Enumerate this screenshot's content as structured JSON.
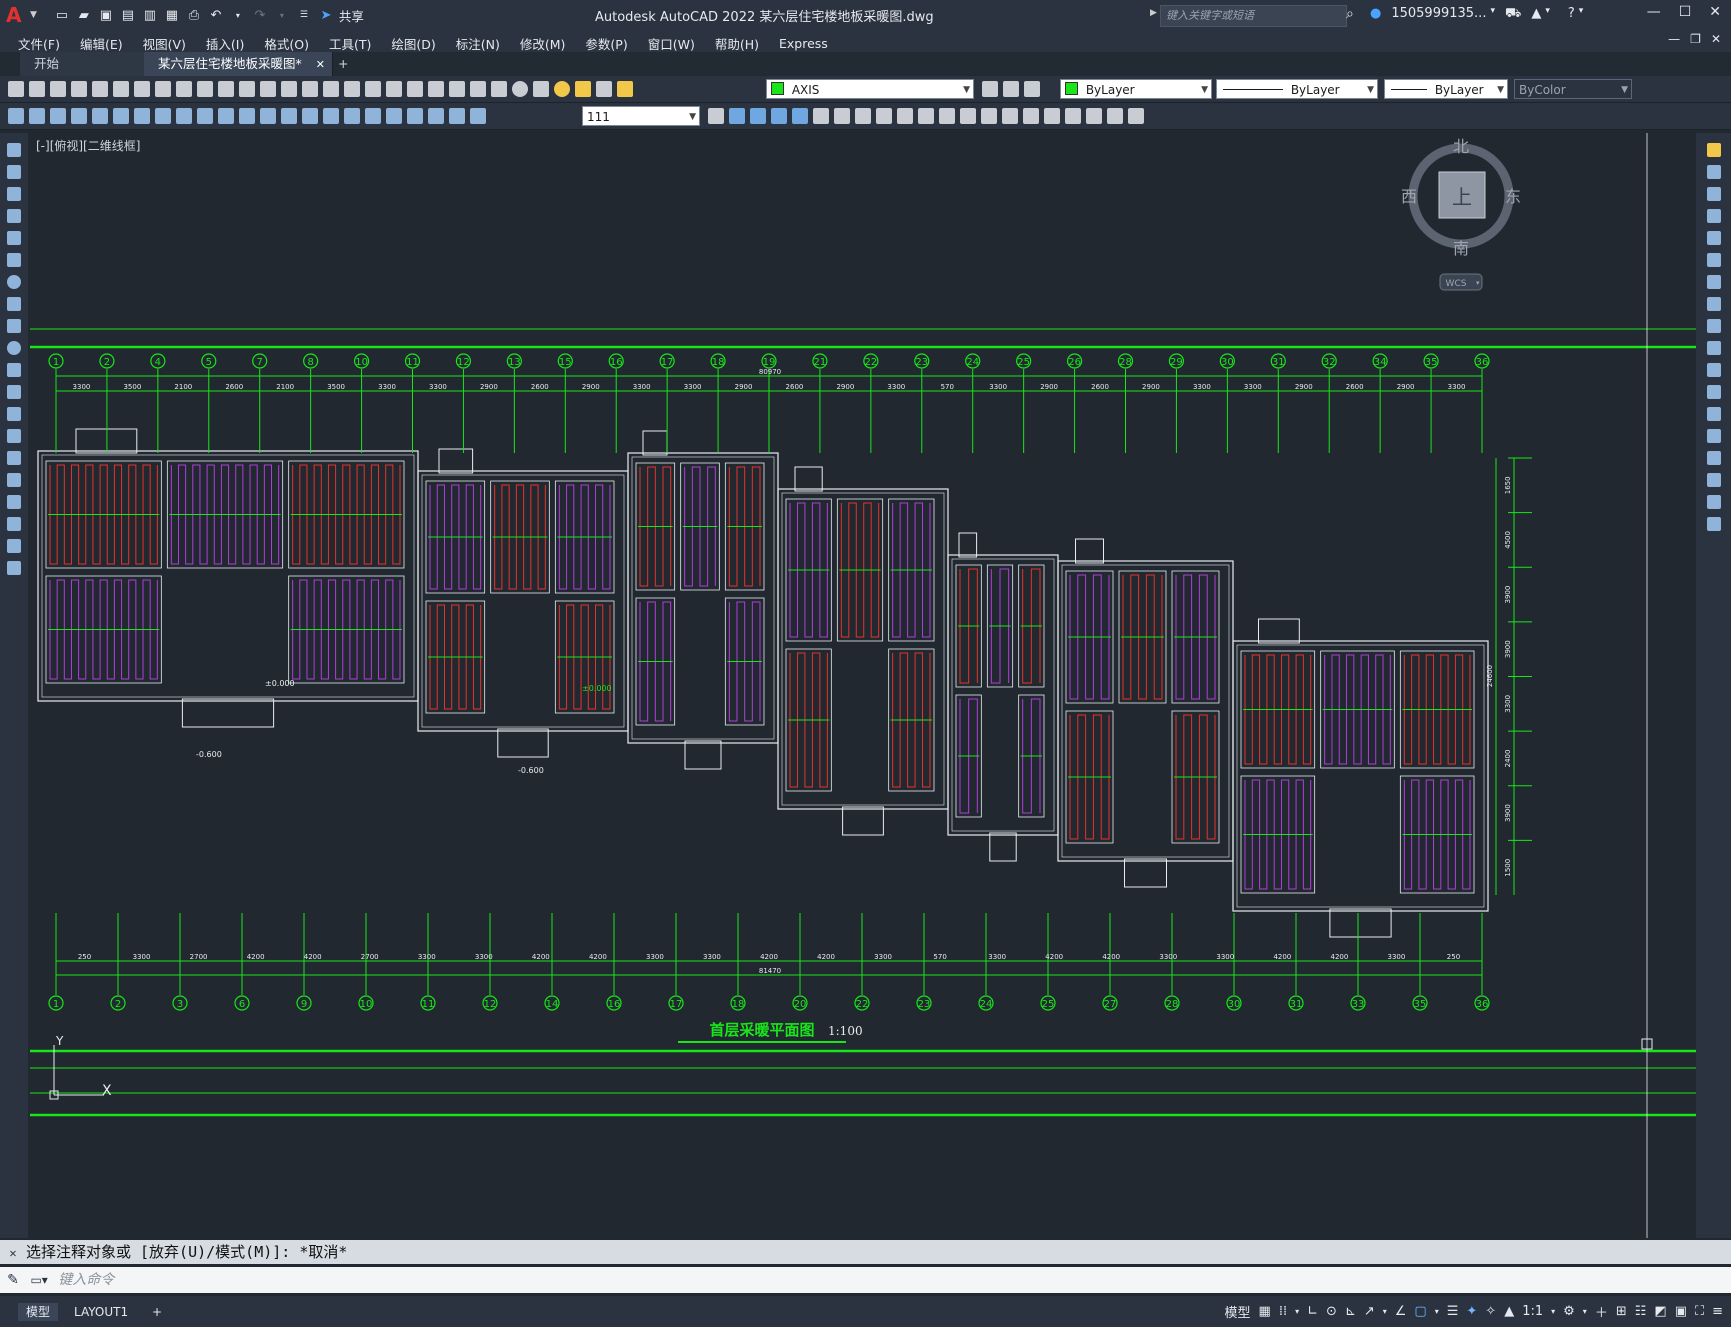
{
  "app": {
    "title": "Autodesk AutoCAD 2022    某六层住宅楼地板采暖图.dwg",
    "logo": "A",
    "share_label": "共享",
    "search_placeholder": "键入关键字或短语",
    "user": "1505999135...",
    "colors": {
      "accent": "#e2322f",
      "cad_green": "#19e619",
      "heating_red": "#e8322a",
      "heating_purple": "#b23cdc",
      "background": "#212830"
    }
  },
  "menu": [
    "文件(F)",
    "编辑(E)",
    "视图(V)",
    "插入(I)",
    "格式(O)",
    "工具(T)",
    "绘图(D)",
    "标注(N)",
    "修改(M)",
    "参数(P)",
    "窗口(W)",
    "帮助(H)",
    "Express"
  ],
  "tabs": [
    {
      "label": "开始"
    },
    {
      "label": "某六层住宅楼地板采暖图*"
    },
    {
      "label": "+"
    }
  ],
  "toolbar": {
    "layer_value": "AXIS",
    "color_value": "ByLayer",
    "linetype_value": "ByLayer",
    "lineweight_value": "ByLayer",
    "plotstyle_value": "ByColor",
    "dimstyle_value": "111"
  },
  "viewport": {
    "label": "[-][俯视][二维线框]"
  },
  "viewcube": {
    "north": "北",
    "south": "南",
    "east": "东",
    "west": "西",
    "top": "上",
    "wcs": "WCS"
  },
  "drawing": {
    "top_axes": [
      "1",
      "2",
      "4",
      "5",
      "7",
      "8",
      "10",
      "11",
      "12",
      "13",
      "15",
      "16",
      "17",
      "18",
      "19",
      "21",
      "22",
      "23",
      "24",
      "25",
      "26",
      "28",
      "29",
      "30",
      "31",
      "32",
      "34",
      "35",
      "36"
    ],
    "top_dims": [
      "3300",
      "3500",
      "2100",
      "2600",
      "2100",
      "3500",
      "3300",
      "3300",
      "2900",
      "2600",
      "2900",
      "3300",
      "3300",
      "2900",
      "2600",
      "2900",
      "3300",
      "570",
      "3300",
      "2900",
      "2600",
      "2900",
      "3300",
      "3300",
      "2900",
      "2600",
      "2900",
      "3300"
    ],
    "top_total": "80970",
    "bottom_axes": [
      "1",
      "2",
      "3",
      "6",
      "9",
      "10",
      "11",
      "12",
      "14",
      "16",
      "17",
      "18",
      "20",
      "22",
      "23",
      "24",
      "25",
      "27",
      "28",
      "30",
      "31",
      "33",
      "35",
      "36"
    ],
    "bottom_dims": [
      "250",
      "3300",
      "2700",
      "4200",
      "4200",
      "2700",
      "3300",
      "3300",
      "4200",
      "4200",
      "3300",
      "3300",
      "4200",
      "4200",
      "3300",
      "570",
      "3300",
      "4200",
      "4200",
      "3300",
      "3300",
      "4200",
      "4200",
      "3300",
      "250"
    ],
    "bottom_total": "81470",
    "right_dims": [
      "1650",
      "4500",
      "3900",
      "3900",
      "3300",
      "2400",
      "3900",
      "1500"
    ],
    "right_total": "24600",
    "elevations": [
      "±0.000",
      "-0.600",
      "±0.000",
      "-0.600"
    ],
    "title": "首层采暖平面图",
    "scale": "1:100",
    "ucs_x": "X",
    "ucs_y": "Y"
  },
  "command": {
    "history": "选择注释对象或 [放弃(U)/模式(M)]: *取消*",
    "placeholder": "键入命令"
  },
  "status": {
    "layout_tabs": [
      "模型",
      "LAYOUT1",
      "+"
    ],
    "model_label": "模型",
    "scale_label": "1:1"
  }
}
